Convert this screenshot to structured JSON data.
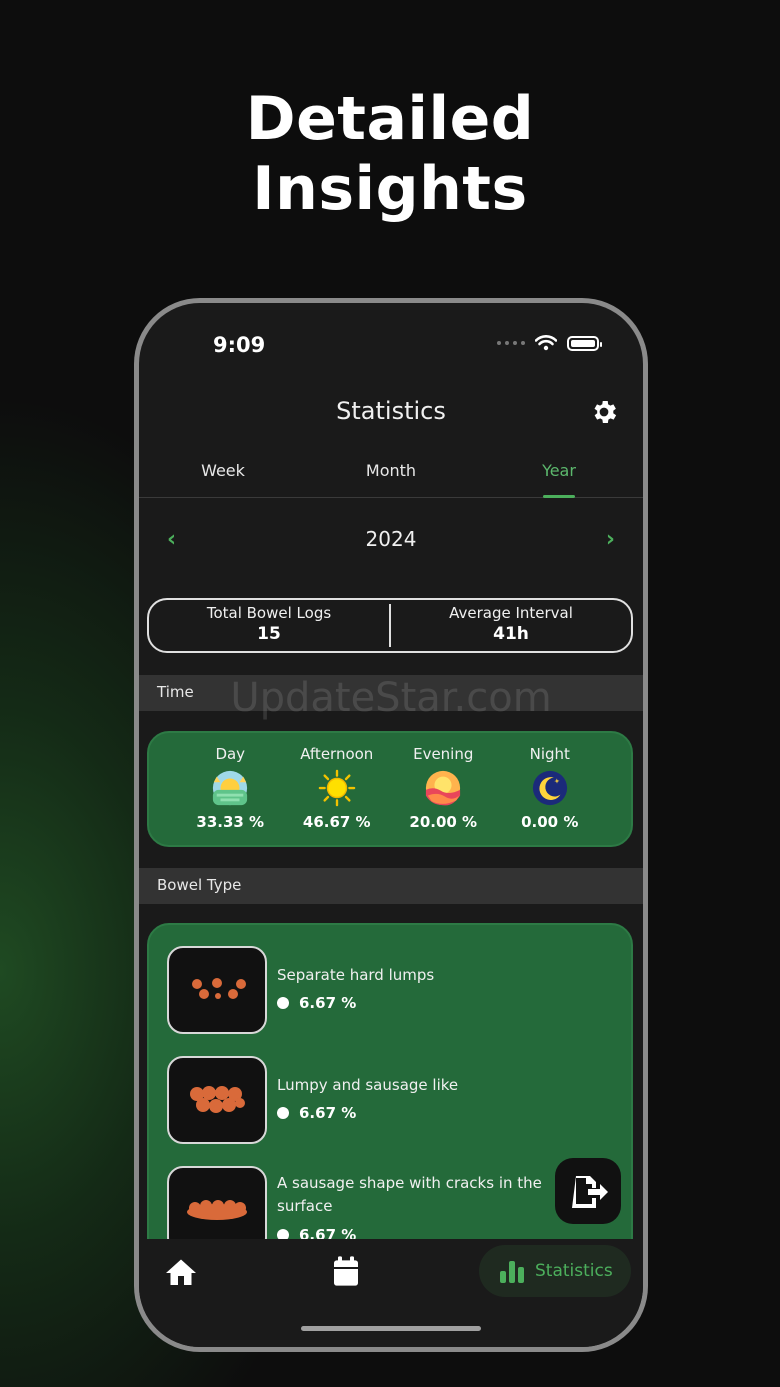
{
  "hero": {
    "line1": "Detailed",
    "line2": "Insights"
  },
  "status_bar": {
    "time": "9:09"
  },
  "header": {
    "title": "Statistics"
  },
  "tabs": [
    {
      "label": "Week",
      "active": false
    },
    {
      "label": "Month",
      "active": false
    },
    {
      "label": "Year",
      "active": true
    }
  ],
  "period": {
    "label": "2024"
  },
  "summary": {
    "total_logs_label": "Total Bowel Logs",
    "total_logs_value": "15",
    "avg_interval_label": "Average Interval",
    "avg_interval_value": "41h"
  },
  "watermark": "UpdateStar.com",
  "time_section": {
    "title": "Time",
    "items": [
      {
        "label": "Day",
        "percent": "33.33 %",
        "icon": "sunrise-icon"
      },
      {
        "label": "Afternoon",
        "percent": "46.67 %",
        "icon": "sun-icon"
      },
      {
        "label": "Evening",
        "percent": "20.00 %",
        "icon": "sunset-icon"
      },
      {
        "label": "Night",
        "percent": "0.00 %",
        "icon": "moon-icon"
      }
    ]
  },
  "bowel_section": {
    "title": "Bowel Type",
    "items": [
      {
        "name": "Separate hard lumps",
        "percent": "6.67 %"
      },
      {
        "name": "Lumpy and sausage like",
        "percent": "6.67 %"
      },
      {
        "name": "A sausage shape with cracks in the surface",
        "percent": "6.67 %"
      }
    ]
  },
  "tabbar": {
    "stats_label": "Statistics"
  },
  "colors": {
    "accent": "#4caf5c",
    "card": "#246a3a",
    "screen_bg": "#1a1a1a"
  }
}
